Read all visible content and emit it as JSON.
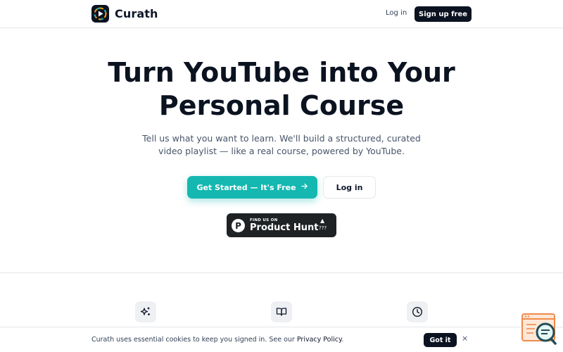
{
  "header": {
    "brand_name": "Curath",
    "login_label": "Log in",
    "signup_label": "Sign up free"
  },
  "hero": {
    "title_line1": "Turn YouTube into Your",
    "title_line2": "Personal Course",
    "subtitle_line1": "Tell us what you want to learn. We'll build a structured, curated",
    "subtitle_line2": "video playlist — like a real course, powered by YouTube.",
    "primary_cta_label": "Get Started — It's Free",
    "primary_cta_icon": "arrow-right-icon",
    "secondary_cta_label": "Log in"
  },
  "product_hunt": {
    "small_text": "FIND US ON",
    "big_text": "Product Hunt",
    "logo_letter": "P",
    "upvote_symbol": "▲",
    "count": "???"
  },
  "features": {
    "icons": [
      "sparkles-icon",
      "book-open-icon",
      "clock-icon"
    ]
  },
  "cookie_banner": {
    "text": "Curath uses essential cookies to keep you signed in. See our ",
    "link_label": "Privacy Policy",
    "text_end": ".",
    "accept_label": "Got it",
    "close_symbol": "×"
  },
  "colors": {
    "primary": "#14b8b0",
    "dark": "#0b1220",
    "product_hunt_bg": "#1f2225"
  }
}
